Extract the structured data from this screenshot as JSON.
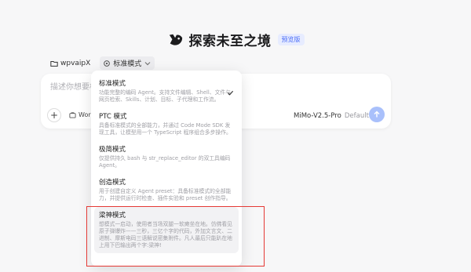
{
  "header": {
    "title": "探索未至之境",
    "badge": "预览版"
  },
  "selectors": {
    "workspace": "wpvaipX",
    "mode": "标准模式"
  },
  "composer": {
    "placeholder": "描述你想要构",
    "work_chip": "Work",
    "model": "MiMo-V2.5-Pro",
    "model_variant": "Default"
  },
  "modes": [
    {
      "name": "标准模式",
      "desc": "功能完整的编码 Agent。支持文件编辑、Shell、文件与网页检索、Skills、计划、目标、子代理和工作流。",
      "selected": true
    },
    {
      "name": "PTC 模式",
      "desc": "具备标准模式的全部能力，并通过 Code Mode SDK 发现工具，让模型用一个 TypeScript 程序组合多步操作。",
      "selected": false
    },
    {
      "name": "极简模式",
      "desc": "仅提供持久 bash 与 str_replace_editor 的双工具编码 Agent。",
      "selected": false
    },
    {
      "name": "创造模式",
      "desc": "用于创建自定义 Agent preset：具备标准模式的全部能力，并提供运行时检查、插件实验和 preset 创作指导。",
      "selected": false
    },
    {
      "name": "梁神模式",
      "desc": "想模式一启动，使用者当场双腿一软瘫坐在地。仿佛看见原子弹爆炸——三秒，三亿个字的代码，外加文言文、二进制、摩斯电码三语解说密集附件。凡人最后只能趴在地上用下巴输出两个字:梁神!",
      "selected": false
    }
  ],
  "colors": {
    "accent": "#4a6cf7",
    "send_button": "#a9c0fb",
    "highlight_box": "#e53935"
  }
}
